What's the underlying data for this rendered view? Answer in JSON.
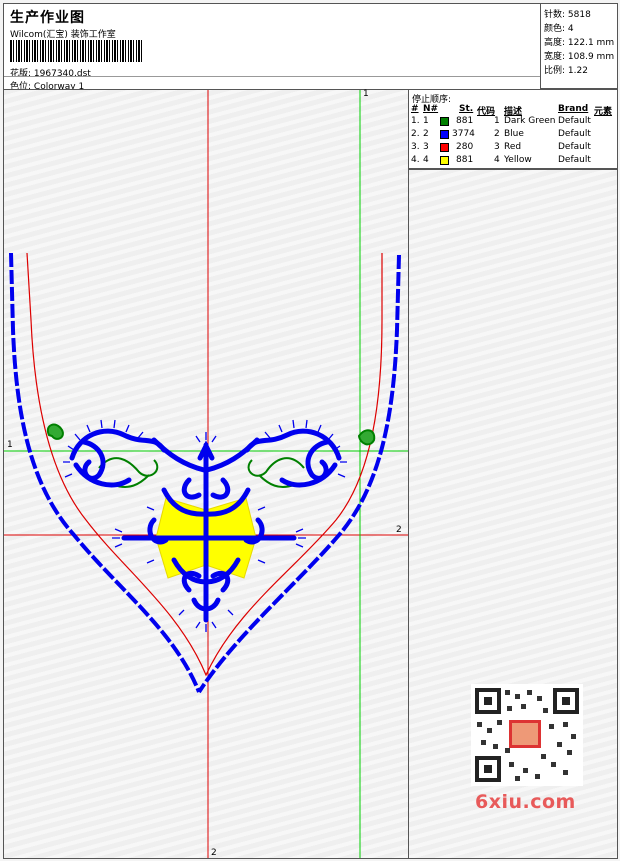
{
  "header": {
    "title": "生产作业图",
    "subtitle": "Wilcom(汇宝) 装饰工作室",
    "file_label": "花版:",
    "file_value": "1967340.dst",
    "color_label": "色位:",
    "color_value": "Colorway 1"
  },
  "stats": {
    "stitches_label": "针数:",
    "stitches_value": "5818",
    "colors_label": "颜色:",
    "colors_value": "4",
    "height_label": "高度:",
    "height_value": "122.1 mm",
    "width_label": "宽度:",
    "width_value": "108.9 mm",
    "scale_label": "比例:",
    "scale_value": "1.22"
  },
  "color_panel": {
    "title": "停止顺序:",
    "headers": {
      "num": "#",
      "n": "N#",
      "st": "St.",
      "code": "代码",
      "desc": "描述",
      "brand": "Brand",
      "element": "元素"
    },
    "rows": [
      {
        "idx": "1.",
        "n": "1",
        "color": "#008000",
        "st": "881",
        "code": "1",
        "desc": "Dark Green",
        "brand": "Default"
      },
      {
        "idx": "2.",
        "n": "2",
        "color": "#0000ff",
        "st": "3774",
        "code": "2",
        "desc": "Blue",
        "brand": "Default"
      },
      {
        "idx": "3.",
        "n": "3",
        "color": "#ff0000",
        "st": "280",
        "code": "3",
        "desc": "Red",
        "brand": "Default"
      },
      {
        "idx": "4.",
        "n": "4",
        "color": "#ffff00",
        "st": "881",
        "code": "4",
        "desc": "Yellow",
        "brand": "Default"
      }
    ]
  },
  "design": {
    "marker_green_top": "1",
    "marker_green_left": "1",
    "marker_red_right": "2",
    "marker_red_bottom": "2",
    "colors": {
      "green_line": "#00cc00",
      "red_line": "#dd0000",
      "blue_stitch": "#0000ee",
      "green_stitch": "#008000",
      "yellow_stitch": "#ffff00"
    }
  },
  "watermark": {
    "site": "6xiu.com"
  }
}
